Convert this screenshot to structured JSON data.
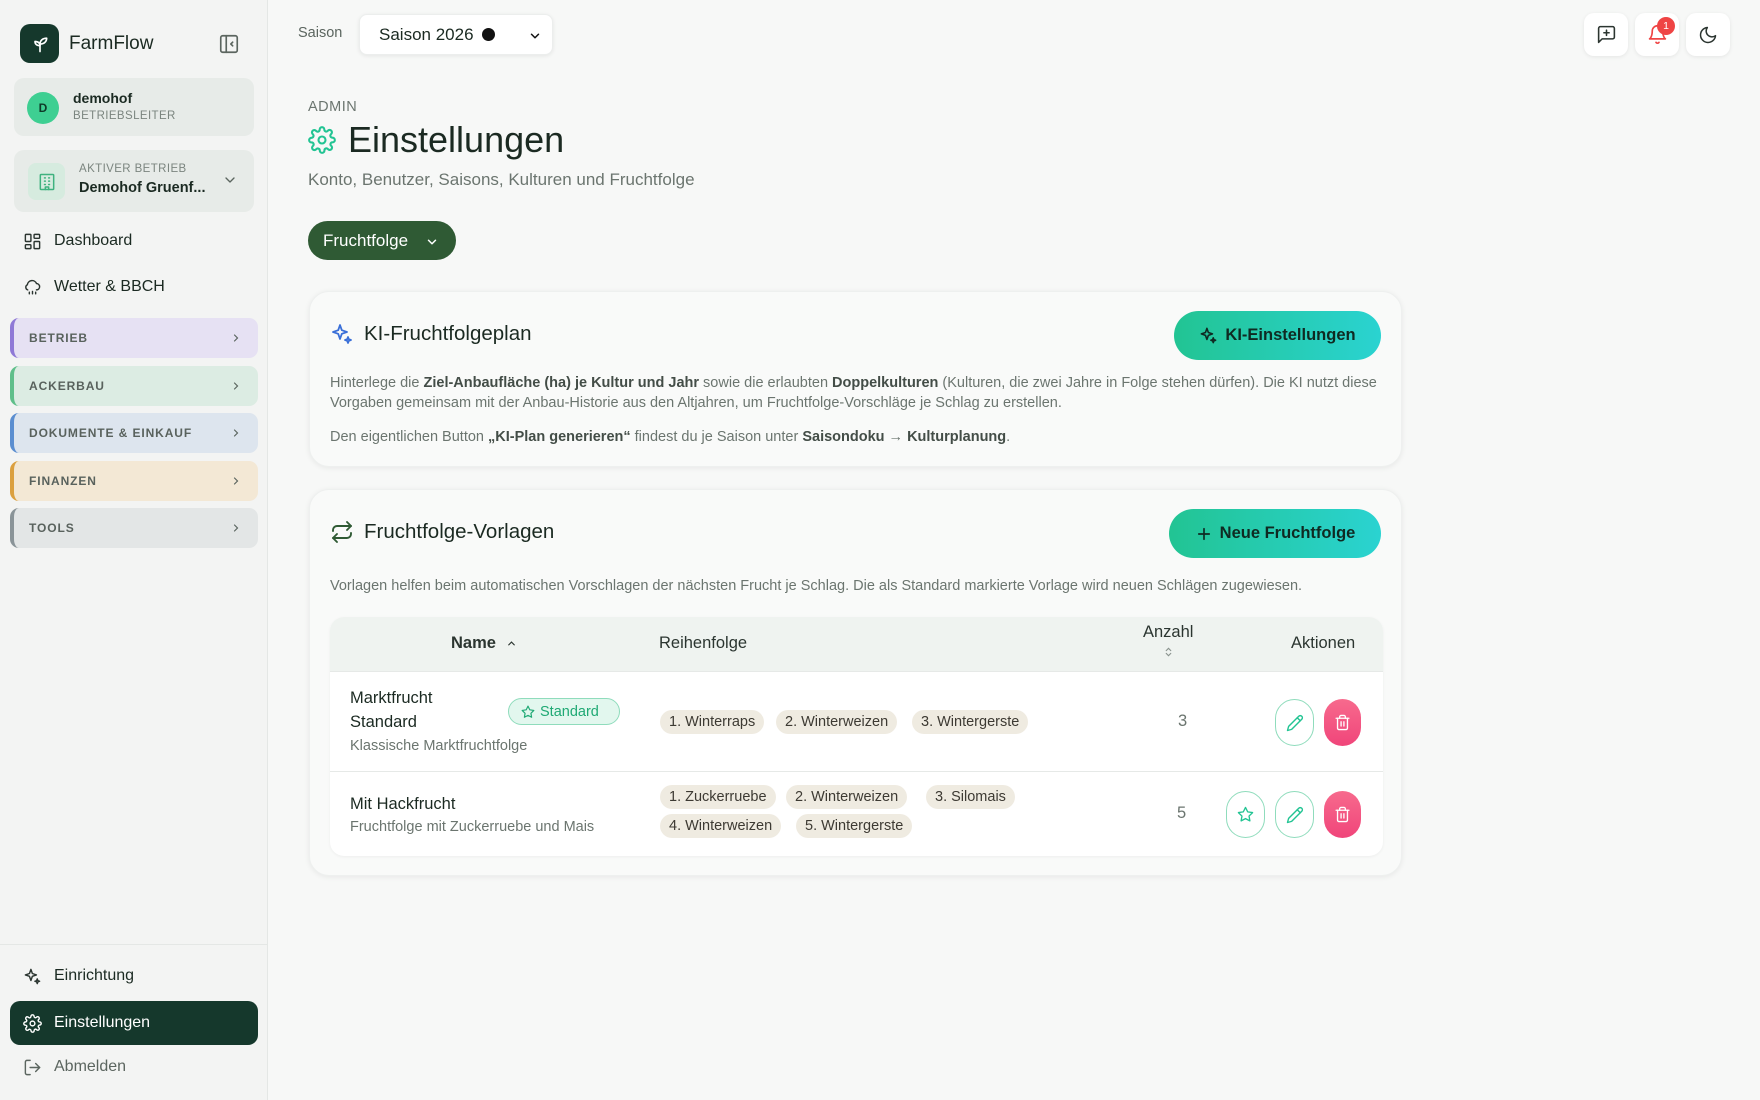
{
  "brand": {
    "name": "FarmFlow",
    "icon": "sprout-icon"
  },
  "user": {
    "initial": "D",
    "name": "demohof",
    "role": "BETRIEBSLEITER"
  },
  "farm": {
    "label": "AKTIVER BETRIEB",
    "name": "Demohof Gruenf..."
  },
  "nav": {
    "dashboard": "Dashboard",
    "weather": "Wetter & BBCH",
    "groups": [
      {
        "label": "BETRIEB",
        "color": "#e6e1f3",
        "accent": "#8f79d6"
      },
      {
        "label": "ACKERBAU",
        "color": "#dcece3",
        "accent": "#5fbf8a"
      },
      {
        "label": "DOKUMENTE & EINKAUF",
        "color": "#dde5ee",
        "accent": "#5b8ed0"
      },
      {
        "label": "FINANZEN",
        "color": "#f3e8d5",
        "accent": "#dba03f"
      },
      {
        "label": "TOOLS",
        "color": "#e3e6e6",
        "accent": "#8a9498"
      }
    ],
    "setup": "Einrichtung",
    "settings": "Einstellungen",
    "logout": "Abmelden"
  },
  "topbar": {
    "season_label": "Saison",
    "season_value": "Saison 2026",
    "notification_count": "1"
  },
  "header": {
    "eyebrow": "ADMIN",
    "title": "Einstellungen",
    "subtitle": "Konto, Benutzer, Saisons, Kulturen und Fruchtfolge",
    "tab": "Fruchtfolge"
  },
  "ai_card": {
    "title": "KI-Fruchtfolgeplan",
    "button": "KI-Einstellungen",
    "p1_a": "Hinterlege die ",
    "p1_b": "Ziel-Anbaufläche (ha) je Kultur und Jahr",
    "p1_c": " sowie die erlaubten ",
    "p1_d": "Doppelkulturen",
    "p1_e": " (Kulturen, die zwei Jahre in Folge stehen dürfen). Die KI nutzt diese Vorgaben gemeinsam mit der Anbau-Historie aus den Altjahren, um Fruchtfolge-Vorschläge je Schlag zu erstellen.",
    "p2_a": "Den eigentlichen Button ",
    "p2_b": "„KI-Plan generieren“",
    "p2_c": " findest du je Saison unter ",
    "p2_d": "Saisondoku",
    "p2_e": " → ",
    "p2_f": "Kulturplanung",
    "p2_g": "."
  },
  "templates_card": {
    "title": "Fruchtfolge-Vorlagen",
    "button": "Neue Fruchtfolge",
    "description": "Vorlagen helfen beim automatischen Vorschlagen der nächsten Frucht je Schlag. Die als Standard markierte Vorlage wird neuen Schlägen zugewiesen.",
    "columns": {
      "name": "Name",
      "sequence": "Reihenfolge",
      "count": "Anzahl",
      "actions": "Aktionen"
    },
    "rows": [
      {
        "name_line1": "Marktfrucht",
        "name_line2": "Standard",
        "badge": "Standard",
        "description": "Klassische Marktfruchtfolge",
        "crops": [
          "1. Winterraps",
          "2. Winterweizen",
          "3. Wintergerste"
        ],
        "count": "3"
      },
      {
        "name_line1": "Mit Hackfrucht",
        "description": "Fruchtfolge mit Zuckerruebe und Mais",
        "crops": [
          "1. Zuckerruebe",
          "2. Winterweizen",
          "3. Silomais",
          "4. Winterweizen",
          "5. Wintergerste"
        ],
        "count": "5"
      }
    ]
  },
  "colors": {
    "primary_dark": "#15382c",
    "tab_green": "#2f5a34",
    "accent_teal": "#22c493",
    "danger": "#f0457a"
  }
}
